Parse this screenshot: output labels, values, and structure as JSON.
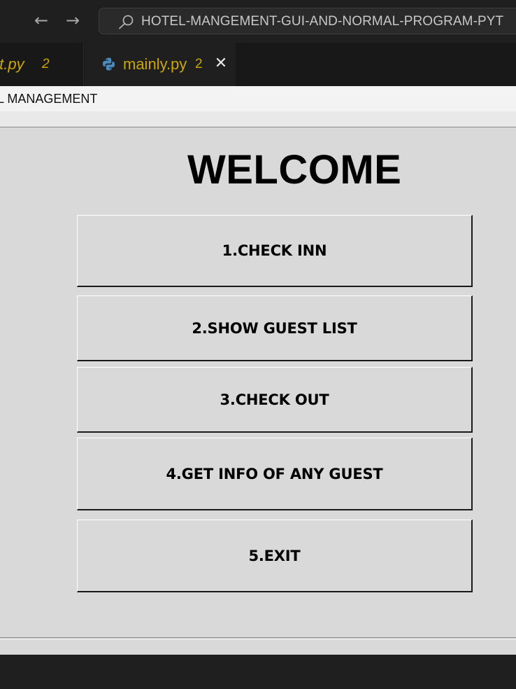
{
  "editor": {
    "nav": {
      "back_icon": "arrow-left-icon",
      "forward_icon": "arrow-right-icon"
    },
    "search": {
      "icon": "search-icon",
      "query": "HOTEL-MANGEMENT-GUI-AND-NORMAL-PROGRAM-PYT"
    },
    "tabs": [
      {
        "label": "ipt.py",
        "problems": "2",
        "active": false
      },
      {
        "label": "mainly.py",
        "problems": "2",
        "active": true,
        "icon": "python-icon",
        "close_icon": "close-icon"
      }
    ]
  },
  "app_window": {
    "title": "EL MANAGEMENT",
    "heading": "WELCOME",
    "buttons": [
      {
        "label": "1.CHECK INN"
      },
      {
        "label": "2.SHOW GUEST LIST"
      },
      {
        "label": "3.CHECK OUT"
      },
      {
        "label": "4.GET INFO OF ANY GUEST"
      },
      {
        "label": "5.EXIT"
      }
    ]
  },
  "colors": {
    "editor_bg": "#1f1f1f",
    "tab_warning": "#cca700",
    "window_bg": "#d9d9d9",
    "titlebar_bg": "#f3f3f3"
  }
}
